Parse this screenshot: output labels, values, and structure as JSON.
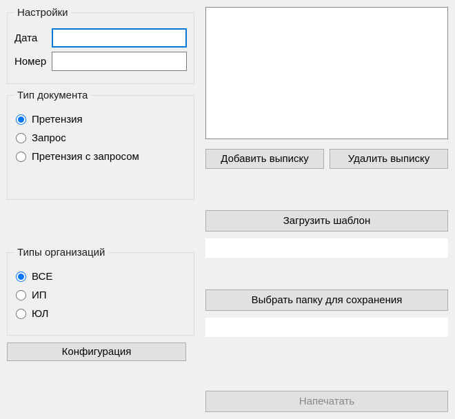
{
  "settings": {
    "legend": "Настройки",
    "date_label": "Дата",
    "date_value": "",
    "number_label": "Номер",
    "number_value": ""
  },
  "doc_type": {
    "legend": "Тип документа",
    "options": {
      "claim": "Претензия",
      "request": "Запрос",
      "claim_request": "Претензия с запросом"
    },
    "selected": "claim"
  },
  "org_types": {
    "legend": "Типы организаций",
    "options": {
      "all": "ВСЕ",
      "ip": "ИП",
      "ul": "ЮЛ"
    },
    "selected": "all"
  },
  "buttons": {
    "config": "Конфигурация",
    "add_statement": "Добавить выписку",
    "delete_statement": "Удалить выписку",
    "load_template": "Загрузить шаблон",
    "choose_folder": "Выбрать папку для сохранения",
    "print": "Напечатать"
  },
  "paths": {
    "template": "",
    "folder": ""
  }
}
